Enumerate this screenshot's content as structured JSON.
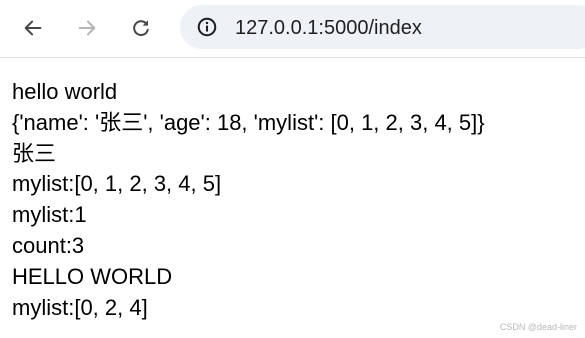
{
  "browser": {
    "url": "127.0.0.1:5000/index",
    "icons": {
      "back": "arrow-left-icon",
      "forward": "arrow-right-icon",
      "reload": "reload-icon",
      "site_info": "info-icon"
    }
  },
  "page": {
    "lines": [
      "hello world",
      "{'name': '张三', 'age': 18, 'mylist': [0, 1, 2, 3, 4, 5]}",
      "张三",
      "mylist:[0, 1, 2, 3, 4, 5]",
      "mylist:1",
      "count:3",
      "HELLO WORLD",
      "mylist:[0, 2, 4]"
    ]
  },
  "watermark": "CSDN @dead-liner"
}
